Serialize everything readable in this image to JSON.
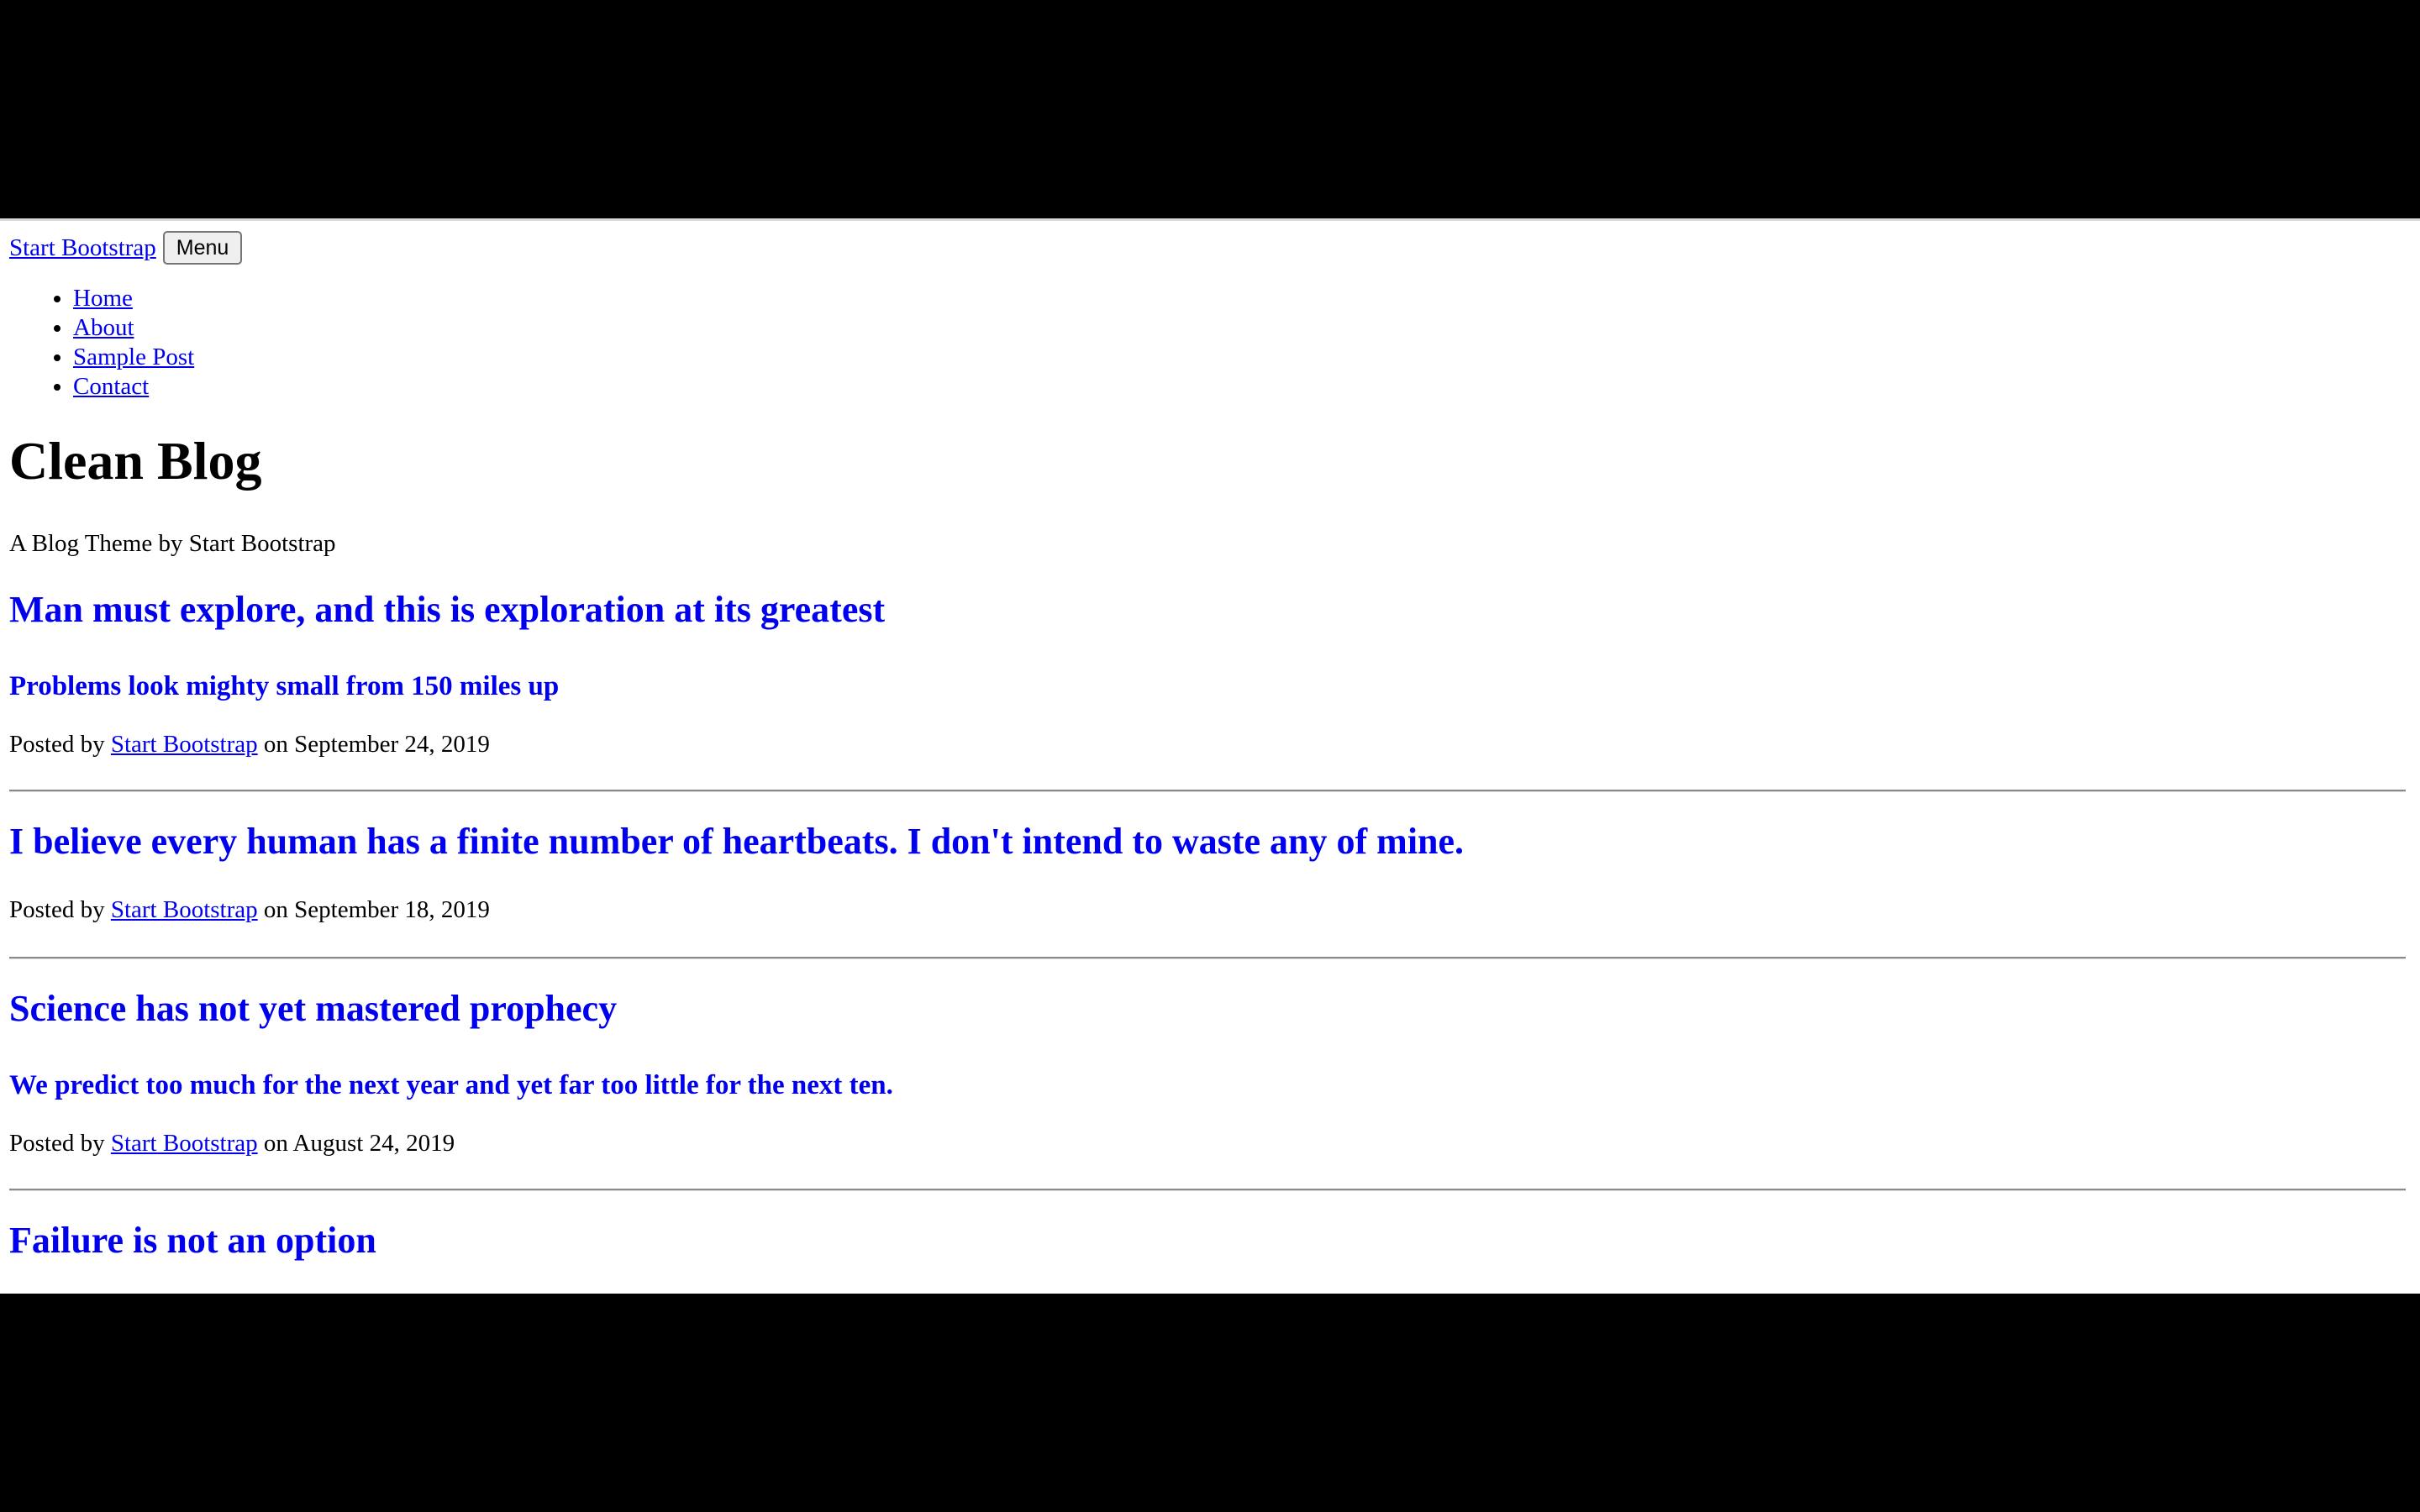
{
  "navbar": {
    "brand": "Start Bootstrap",
    "menu_button": "Menu",
    "items": [
      {
        "label": "Home"
      },
      {
        "label": "About"
      },
      {
        "label": "Sample Post"
      },
      {
        "label": "Contact"
      }
    ]
  },
  "header": {
    "title": "Clean Blog",
    "subtitle": "A Blog Theme by Start Bootstrap"
  },
  "posts": [
    {
      "title": "Man must explore, and this is exploration at its greatest",
      "subtitle": "Problems look mighty small from 150 miles up",
      "meta_prefix": "Posted by",
      "author": "Start Bootstrap",
      "meta_suffix": "on September 24, 2019"
    },
    {
      "title": "I believe every human has a finite number of heartbeats. I don't intend to waste any of mine.",
      "meta_prefix": "Posted by",
      "author": "Start Bootstrap",
      "meta_suffix": "on September 18, 2019"
    },
    {
      "title": "Science has not yet mastered prophecy",
      "subtitle": "We predict too much for the next year and yet far too little for the next ten.",
      "meta_prefix": "Posted by",
      "author": "Start Bootstrap",
      "meta_suffix": "on August 24, 2019"
    },
    {
      "title": "Failure is not an option"
    }
  ]
}
